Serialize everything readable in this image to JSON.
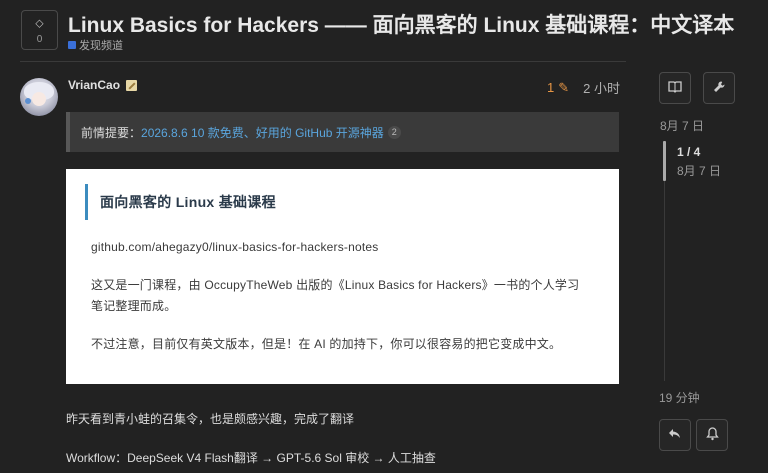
{
  "topic": {
    "vote_arrow": "⬦",
    "vote_count": "0",
    "title": "Linux Basics for Hackers —— 面向黑客的 Linux 基础课程：中文译本",
    "category": "发现频道",
    "category_color": "#3a6fd8"
  },
  "post": {
    "username": "VrianCao",
    "edit_count": "1",
    "edit_icon": "pencil-icon",
    "time_ago": "2 小时",
    "notice": {
      "label": "前情提要：",
      "link_text": "2026.8.6 10 款免费、好用的 GitHub 开源神器",
      "link_count": "2"
    },
    "card": {
      "title": "面向黑客的 Linux 基础课程",
      "repo": "github.com/ahegazy0/linux-basics-for-hackers-notes",
      "para1": "这又是一门课程，由 OccupyTheWeb 出版的《Linux Basics for Hackers》一书的个人学习笔记整理而成。",
      "para2": "不过注意，目前仅有英文版本，但是！在 AI 的加持下，你可以很容易的把它变成中文。"
    },
    "line1": "昨天看到青小蛙的召集令，也是颇感兴趣，完成了翻译",
    "line2": "Workflow：DeepSeek V4 Flash翻译 → GPT-5.6 Sol 审校 → 人工抽查"
  },
  "timeline": {
    "top_date": "8月 7 日",
    "progress": "1 / 4",
    "progress_date": "8月 7 日",
    "bottom_date": "19 分钟",
    "btn_summary_icon": "book-open-icon",
    "btn_admin_icon": "wrench-icon",
    "btn_reply_icon": "reply-icon",
    "btn_notify_icon": "bell-icon"
  },
  "colors": {
    "background": "#222222",
    "accent_orange": "#e59545",
    "link_blue": "#5aa5dd",
    "card_border": "#3c8cbf"
  }
}
